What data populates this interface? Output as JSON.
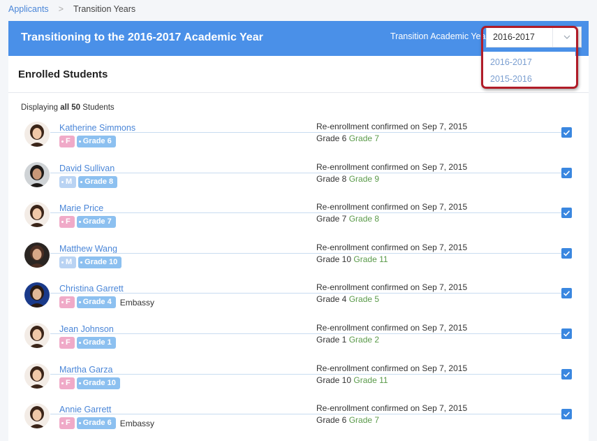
{
  "breadcrumb": {
    "link": "Applicants",
    "separator": ">",
    "current": "Transition Years"
  },
  "header": {
    "title": "Transitioning to the 2016-2017 Academic Year",
    "year_label": "Transition Academic Year:",
    "year_selected": "2016-2017",
    "year_options": [
      "2016-2017",
      "2015-2016"
    ]
  },
  "panel": {
    "title": "Enrolled Students",
    "displaying_prefix": "Displaying",
    "displaying_count": "all 50",
    "displaying_suffix": "Students"
  },
  "students": [
    {
      "name": "Katherine Simmons",
      "gender": "F",
      "grade_tag": "Grade 6",
      "extra": "",
      "status": "Re-enrollment confirmed on Sep 7, 2015",
      "grade_from": "Grade 6",
      "grade_to": "Grade 7",
      "checked": true
    },
    {
      "name": "David Sullivan",
      "gender": "M",
      "grade_tag": "Grade 8",
      "extra": "",
      "status": "Re-enrollment confirmed on Sep 7, 2015",
      "grade_from": "Grade 8",
      "grade_to": "Grade 9",
      "checked": true
    },
    {
      "name": "Marie Price",
      "gender": "F",
      "grade_tag": "Grade 7",
      "extra": "",
      "status": "Re-enrollment confirmed on Sep 7, 2015",
      "grade_from": "Grade 7",
      "grade_to": "Grade 8",
      "checked": true
    },
    {
      "name": "Matthew Wang",
      "gender": "M",
      "grade_tag": "Grade 10",
      "extra": "",
      "status": "Re-enrollment confirmed on Sep 7, 2015",
      "grade_from": "Grade 10",
      "grade_to": "Grade 11",
      "checked": true
    },
    {
      "name": "Christina Garrett",
      "gender": "F",
      "grade_tag": "Grade 4",
      "extra": "Embassy",
      "status": "Re-enrollment confirmed on Sep 7, 2015",
      "grade_from": "Grade 4",
      "grade_to": "Grade 5",
      "checked": true
    },
    {
      "name": "Jean Johnson",
      "gender": "F",
      "grade_tag": "Grade 1",
      "extra": "",
      "status": "Re-enrollment confirmed on Sep 7, 2015",
      "grade_from": "Grade 1",
      "grade_to": "Grade 2",
      "checked": true
    },
    {
      "name": "Martha Garza",
      "gender": "F",
      "grade_tag": "Grade 10",
      "extra": "",
      "status": "Re-enrollment confirmed on Sep 7, 2015",
      "grade_from": "Grade 10",
      "grade_to": "Grade 11",
      "checked": true
    },
    {
      "name": "Annie Garrett",
      "gender": "F",
      "grade_tag": "Grade 6",
      "extra": "Embassy",
      "status": "Re-enrollment confirmed on Sep 7, 2015",
      "grade_from": "Grade 6",
      "grade_to": "Grade 7",
      "checked": true
    }
  ],
  "colors": {
    "header_bg": "#4a90e8",
    "link": "#4a86d8",
    "grade_next": "#5a9a4a",
    "checkbox": "#3a87e0",
    "highlight": "#b01c28",
    "tag_female": "#f0aac8",
    "tag_male": "#b9d3f3",
    "tag_grade": "#8cc0f0"
  },
  "icons": {
    "dropdown": "chevron-down-icon",
    "checkbox": "check-icon"
  }
}
